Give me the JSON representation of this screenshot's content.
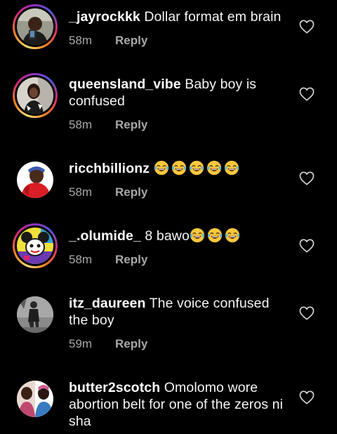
{
  "comments": [
    {
      "username": "_jayrockkk",
      "text": "Dollar format em brain",
      "time": "58m",
      "reply": "Reply",
      "avatar": "profile-photo-man-with-phone",
      "story_ring": true
    },
    {
      "username": "queensland_vibe",
      "text": "Baby boy is confused",
      "time": "58m",
      "reply": "Reply",
      "avatar": "profile-photo-woman-selfie",
      "story_ring": true
    },
    {
      "username": "ricchbillionz",
      "text": "",
      "emoji_count": 5,
      "emoji": "face-with-tears-of-joy",
      "time": "58m",
      "reply": "Reply",
      "avatar": "profile-photo-red-hoodie",
      "story_ring": false
    },
    {
      "username": "_.olumide_",
      "text": "8 bawo",
      "emoji_count": 3,
      "emoji": "face-with-tears-of-joy",
      "time": "58m",
      "reply": "Reply",
      "avatar": "profile-cartoon-mouse",
      "story_ring": true
    },
    {
      "username": "itz_daureen",
      "text": "The voice confused the boy",
      "time": "59m",
      "reply": "Reply",
      "avatar": "profile-photo-woman-standing",
      "story_ring": false
    },
    {
      "username": "butter2scotch",
      "text": "Omolomo wore abortion belt for one of the zeros ni sha",
      "time": "",
      "reply": "",
      "avatar": "profile-photo-two-women",
      "story_ring": false
    }
  ],
  "icons": {
    "like": "heart-outline-icon"
  },
  "colors": {
    "background": "#000000",
    "text": "#f5f5f5",
    "meta": "#a8a8a8"
  }
}
